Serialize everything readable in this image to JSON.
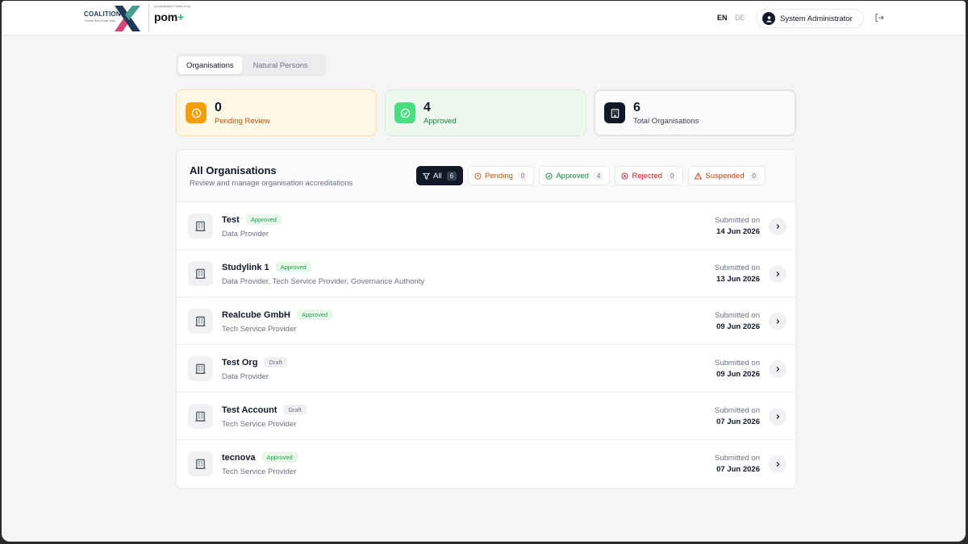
{
  "header": {
    "brand_name": "COALITION",
    "brand_sub": "Trusted Real Estate Data",
    "accreditation_caption": "Accreditation Powered by",
    "pom_logo": "pom",
    "pom_plus": "+",
    "lang_en": "EN",
    "lang_de": "DE",
    "user_name": "System Administrator"
  },
  "tabs": [
    {
      "label": "Organisations",
      "active": true
    },
    {
      "label": "Natural Persons",
      "active": false
    }
  ],
  "stats": {
    "pending": {
      "value": "0",
      "label": "Pending Review"
    },
    "approved": {
      "value": "4",
      "label": "Approved"
    },
    "total": {
      "value": "6",
      "label": "Total Organisations"
    }
  },
  "list": {
    "title": "All Organisations",
    "subtitle": "Review and manage organisation accreditations",
    "filters": [
      {
        "label": "All",
        "count": "6",
        "icon": "filter-icon"
      },
      {
        "label": "Pending",
        "count": "0",
        "icon": "clock-icon"
      },
      {
        "label": "Approved",
        "count": "4",
        "icon": "check-circle-icon"
      },
      {
        "label": "Rejected",
        "count": "0",
        "icon": "x-circle-icon"
      },
      {
        "label": "Suspended",
        "count": "0",
        "icon": "warning-icon"
      }
    ],
    "submitted_label": "Submitted on",
    "rows": [
      {
        "name": "Test",
        "status": "Approved",
        "type": "Data Provider",
        "date": "14 Jun 2026"
      },
      {
        "name": "Studylink 1",
        "status": "Approved",
        "type": "Data Provider, Tech Service Provider, Governance Authority",
        "date": "13 Jun 2026"
      },
      {
        "name": "Realcube GmbH",
        "status": "Approved",
        "type": "Tech Service Provider",
        "date": "09 Jun 2026"
      },
      {
        "name": "Test Org",
        "status": "Draft",
        "type": "Data Provider",
        "date": "09 Jun 2026"
      },
      {
        "name": "Test Account",
        "status": "Draft",
        "type": "Tech Service Provider",
        "date": "07 Jun 2026"
      },
      {
        "name": "tecnova",
        "status": "Approved",
        "type": "Tech Service Provider",
        "date": "07 Jun 2026"
      }
    ]
  },
  "colors": {
    "pending_accent": "#f59e0b",
    "approved_accent": "#4ade80",
    "dark": "#111827"
  }
}
